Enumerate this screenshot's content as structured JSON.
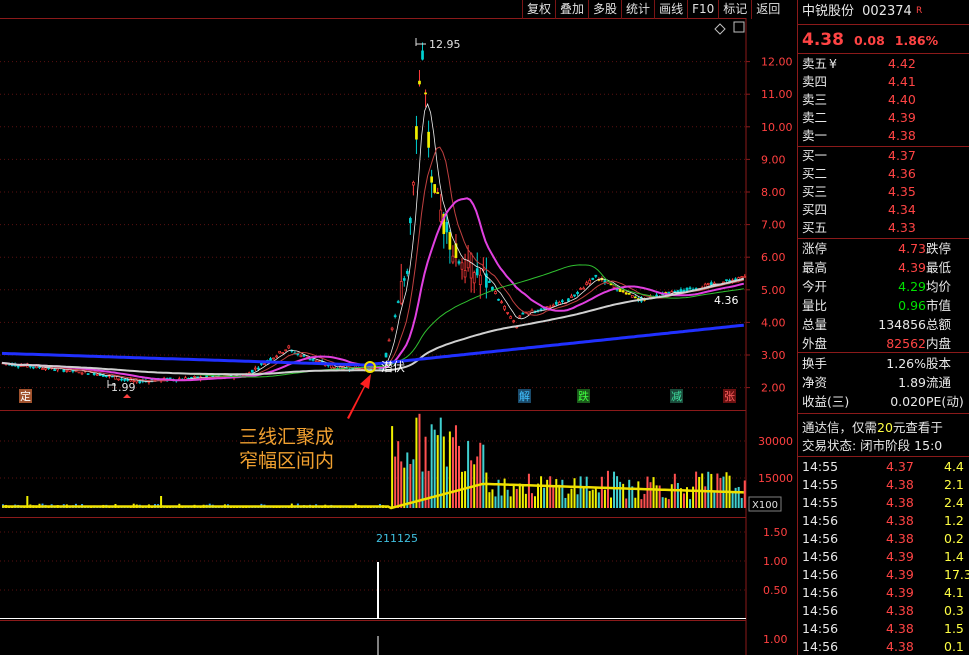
{
  "toolbar": {
    "items": [
      "复权",
      "叠加",
      "多股",
      "统计",
      "画线",
      "F10",
      "标记",
      "返回"
    ]
  },
  "stock": {
    "name": "中锐股份",
    "code": "002374",
    "code_suffix": "R",
    "price": "4.38",
    "change": "0.08",
    "change_pct": "1.86%"
  },
  "orderbook": {
    "sell": [
      {
        "label": "卖五",
        "extra": "¥",
        "price": "4.42"
      },
      {
        "label": "卖四",
        "extra": "",
        "price": "4.41"
      },
      {
        "label": "卖三",
        "extra": "",
        "price": "4.40"
      },
      {
        "label": "卖二",
        "extra": "",
        "price": "4.39"
      },
      {
        "label": "卖一",
        "extra": "",
        "price": "4.38"
      }
    ],
    "buy": [
      {
        "label": "买一",
        "price": "4.37"
      },
      {
        "label": "买二",
        "price": "4.36"
      },
      {
        "label": "买三",
        "price": "4.35"
      },
      {
        "label": "买四",
        "price": "4.34"
      },
      {
        "label": "买五",
        "price": "4.33"
      }
    ]
  },
  "stats": [
    {
      "l1": "涨停",
      "v1": "4.73",
      "c1": "red",
      "l2": "跌停"
    },
    {
      "l1": "最高",
      "v1": "4.39",
      "c1": "red",
      "l2": "最低"
    },
    {
      "l1": "今开",
      "v1": "4.29",
      "c1": "green",
      "l2": "均价"
    },
    {
      "l1": "量比",
      "v1": "0.96",
      "c1": "green",
      "l2": "市值"
    },
    {
      "l1": "总量",
      "v1": "134856",
      "c1": "white",
      "l2": "总额"
    },
    {
      "l1": "外盘",
      "v1": "82562",
      "c1": "red",
      "l2": "内盘"
    }
  ],
  "stats2": [
    {
      "l1": "换手",
      "v1": "1.26%",
      "l2": "股本"
    },
    {
      "l1": "净资",
      "v1": "1.89",
      "l2": "流通"
    },
    {
      "l1": "收益(三)",
      "v1": "0.020",
      "l2": "PE(动)"
    }
  ],
  "promo": {
    "pre": "通达信，仅需",
    "num": "20",
    "post": "元查看于"
  },
  "trade_status": "交易状态: 闭市阶段 15:0",
  "ticks": [
    {
      "t": "14:55",
      "p": "4.37",
      "pc": "red",
      "v": "4.4",
      "vc": "yellow"
    },
    {
      "t": "14:55",
      "p": "4.38",
      "pc": "red",
      "v": "2.1",
      "vc": "yellow"
    },
    {
      "t": "14:55",
      "p": "4.38",
      "pc": "red",
      "v": "2.4",
      "vc": "yellow"
    },
    {
      "t": "14:56",
      "p": "4.38",
      "pc": "red",
      "v": "1.2",
      "vc": "yellow"
    },
    {
      "t": "14:56",
      "p": "4.38",
      "pc": "red",
      "v": "0.2",
      "vc": "yellow"
    },
    {
      "t": "14:56",
      "p": "4.39",
      "pc": "red",
      "v": "1.4",
      "vc": "yellow"
    },
    {
      "t": "14:56",
      "p": "4.39",
      "pc": "red",
      "v": "17.3",
      "vc": "yellow"
    },
    {
      "t": "14:56",
      "p": "4.39",
      "pc": "red",
      "v": "4.1",
      "vc": "yellow"
    },
    {
      "t": "14:56",
      "p": "4.38",
      "pc": "red",
      "v": "0.3",
      "vc": "yellow"
    },
    {
      "t": "14:56",
      "p": "4.38",
      "pc": "red",
      "v": "1.5",
      "vc": "yellow"
    },
    {
      "t": "14:56",
      "p": "4.38",
      "pc": "red",
      "v": "0.1",
      "vc": "yellow"
    }
  ],
  "price_axis": [
    "12.00",
    "11.00",
    "10.00",
    "9.00",
    "8.00",
    "7.00",
    "6.00",
    "5.00",
    "4.00",
    "3.00",
    "2.00"
  ],
  "volume_axis": [
    "30000",
    "15000"
  ],
  "volume_unit": "X100",
  "indicator_axis": [
    "1.50",
    "1.00",
    "0.50"
  ],
  "indicator_axis2": [
    "1.00"
  ],
  "labels": {
    "high": "12.95",
    "low": "1.99",
    "right_value": "4.36",
    "indicator_peak": "211125",
    "marker_text": "潜伏"
  },
  "annotation": {
    "line1": "三线汇聚成",
    "line2": "窄幅区间内"
  },
  "event_tags": [
    {
      "text": "定",
      "bg": "#a0522d",
      "color": "#ffffff"
    },
    {
      "text": "解",
      "bg": "#1a4a6a",
      "color": "#40c0ff"
    },
    {
      "text": "跌",
      "bg": "#1a5a1a",
      "color": "#40ff40"
    },
    {
      "text": "减",
      "bg": "#1a4a3a",
      "color": "#40e0a0"
    },
    {
      "text": "张",
      "bg": "#6a1010",
      "color": "#ff6060"
    }
  ],
  "colors": {
    "up": "#ff3c3c",
    "down": "#00d0d0",
    "ma_yellow": "#f0e000",
    "ma_magenta": "#e040e0",
    "ma_blue": "#2030ff",
    "ma_white": "#d0d0d0"
  }
}
